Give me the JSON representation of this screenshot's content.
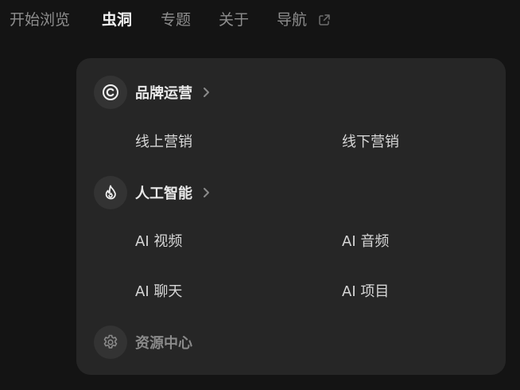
{
  "nav": {
    "items": [
      {
        "label": "开始浏览"
      },
      {
        "label": "虫洞"
      },
      {
        "label": "专题"
      },
      {
        "label": "关于"
      },
      {
        "label": "导航"
      }
    ],
    "active": "虫洞",
    "external_icon": "external-link-icon"
  },
  "menu": {
    "groups": [
      {
        "title": "品牌运营",
        "icon": "copyright-icon",
        "items": [
          {
            "label": "线上营销"
          },
          {
            "label": "线下营销"
          }
        ]
      },
      {
        "title": "人工智能",
        "icon": "flame-icon",
        "items": [
          {
            "label": "AI 视频"
          },
          {
            "label": "AI 音频"
          },
          {
            "label": "AI 聊天"
          },
          {
            "label": "AI 项目"
          }
        ]
      },
      {
        "title": "资源中心",
        "icon": "gear-icon",
        "items": []
      }
    ]
  },
  "colors": {
    "page_bg": "#141414",
    "panel_bg": "#262626",
    "icon_bg": "#333333",
    "nav_active": "#f2f2f2",
    "nav_inactive": "#8e8e8e"
  }
}
